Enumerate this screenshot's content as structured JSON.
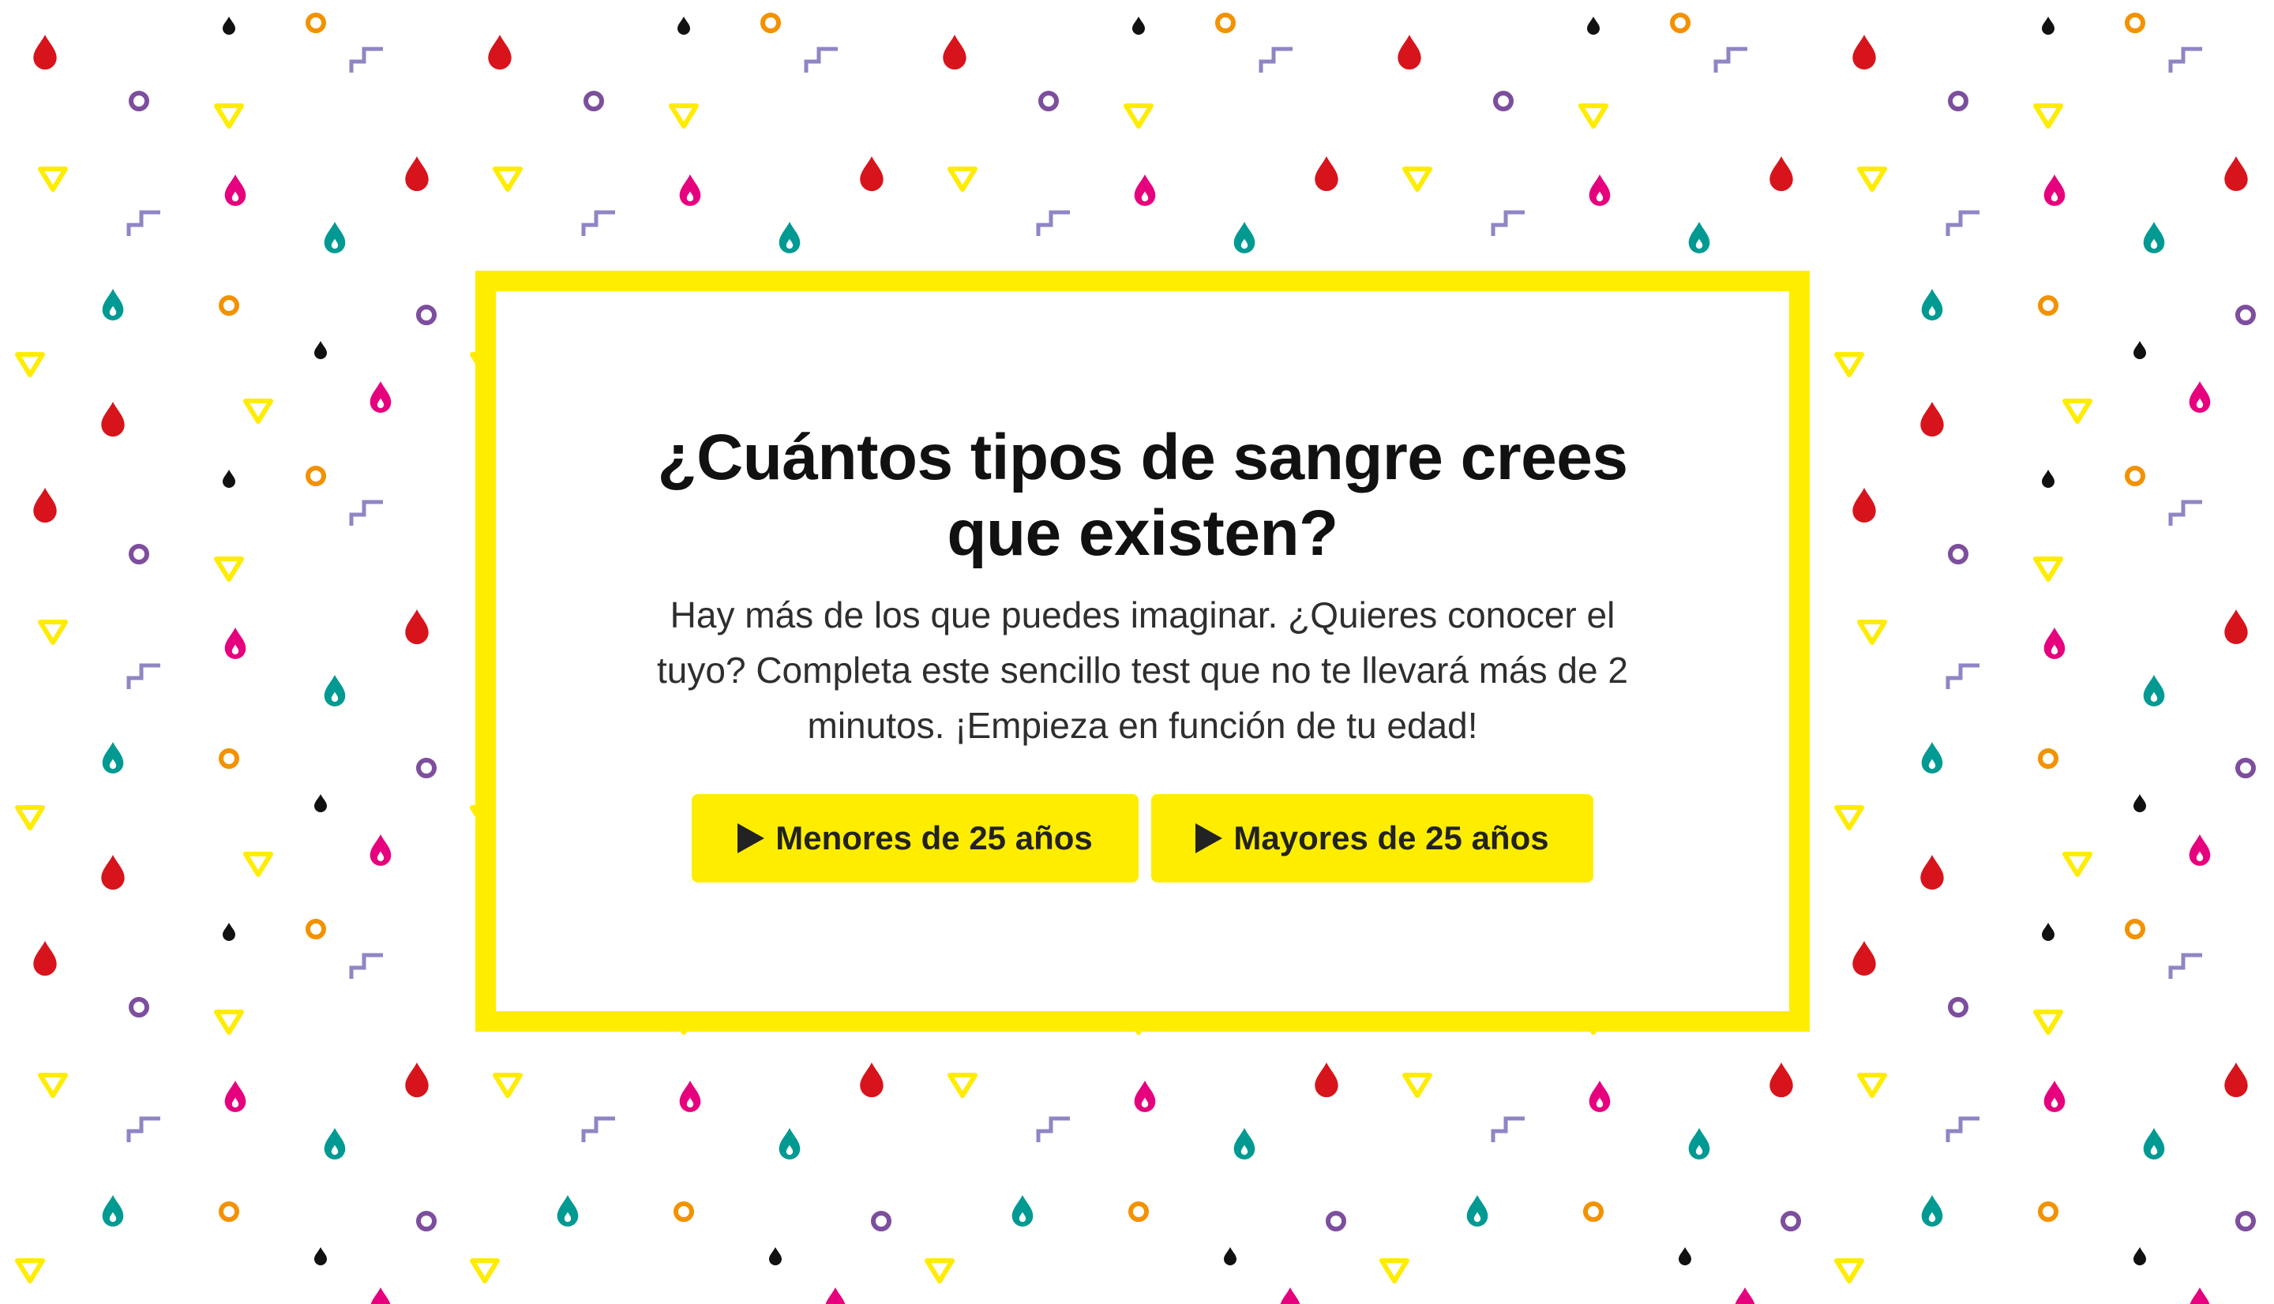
{
  "quiz": {
    "title": "¿Cuántos tipos de sangre crees que existen?",
    "description": "Hay más de los que puedes imaginar. ¿Quieres conocer el tuyo? Completa este sencillo test que no te llevará más de 2 minutos. ¡Empieza en función de tu edad!",
    "buttons": [
      {
        "label": "Menores de 25 años",
        "icon": "play-icon"
      },
      {
        "label": "Mayores de 25 años",
        "icon": "play-icon"
      }
    ]
  },
  "colors": {
    "accent_yellow": "#ffed00",
    "drop_red": "#d7141c",
    "drop_pink": "#e6007e",
    "drop_teal": "#009a93",
    "ring_orange": "#f39200",
    "ring_purple": "#7d4e9e",
    "dot_black": "#111111",
    "step_lavender": "#8e86c4",
    "triangle_yellow": "#ffec00"
  },
  "background_pattern": {
    "icons": [
      "blood-drop-icon",
      "ring-icon",
      "triangle-icon",
      "dot-icon",
      "step-icon"
    ]
  }
}
